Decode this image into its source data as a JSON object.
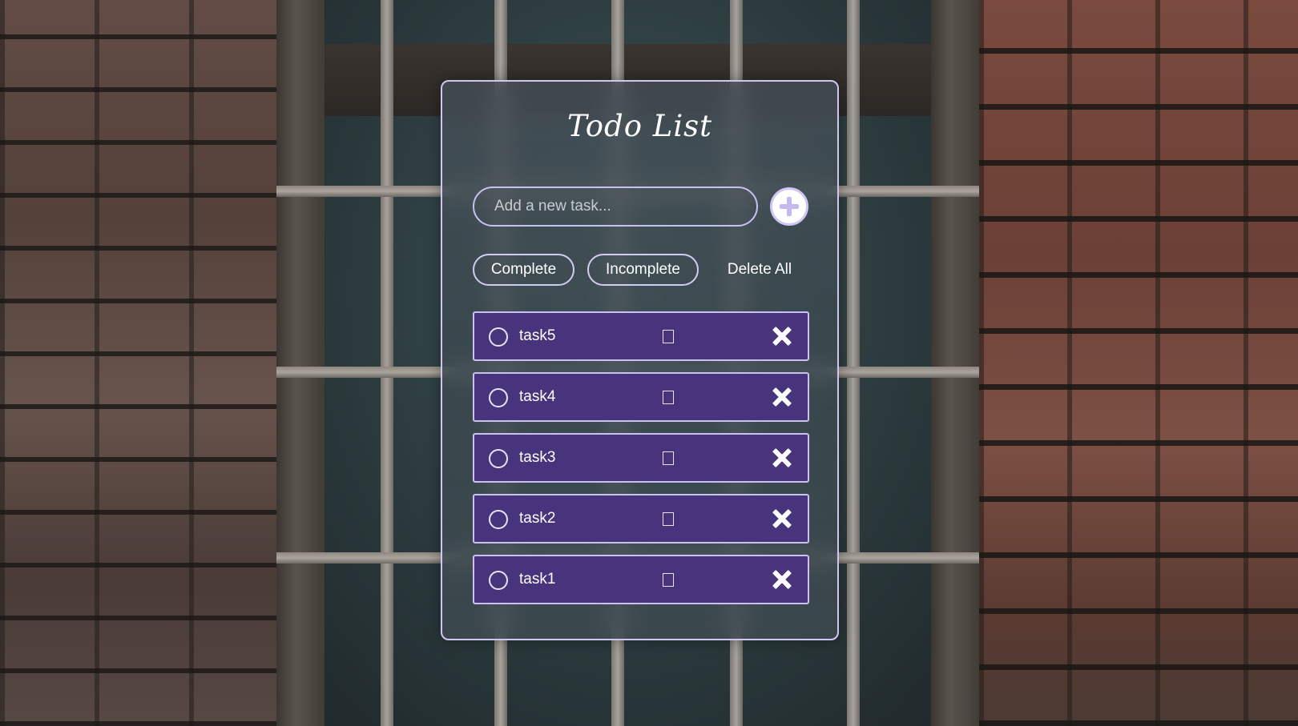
{
  "app": {
    "title": "Todo List"
  },
  "input": {
    "value": "",
    "placeholder": "Add a new task..."
  },
  "add_button": {
    "icon": "plus-icon"
  },
  "filters": {
    "complete_label": "Complete",
    "incomplete_label": "Incomplete",
    "delete_all_label": "Delete All"
  },
  "tasks": [
    {
      "label": "task5"
    },
    {
      "label": "task4"
    },
    {
      "label": "task3"
    },
    {
      "label": "task2"
    },
    {
      "label": "task1"
    }
  ],
  "colors": {
    "task_background": "#47347c",
    "accent_border": "#cbc1f1",
    "text": "#ffffff"
  }
}
